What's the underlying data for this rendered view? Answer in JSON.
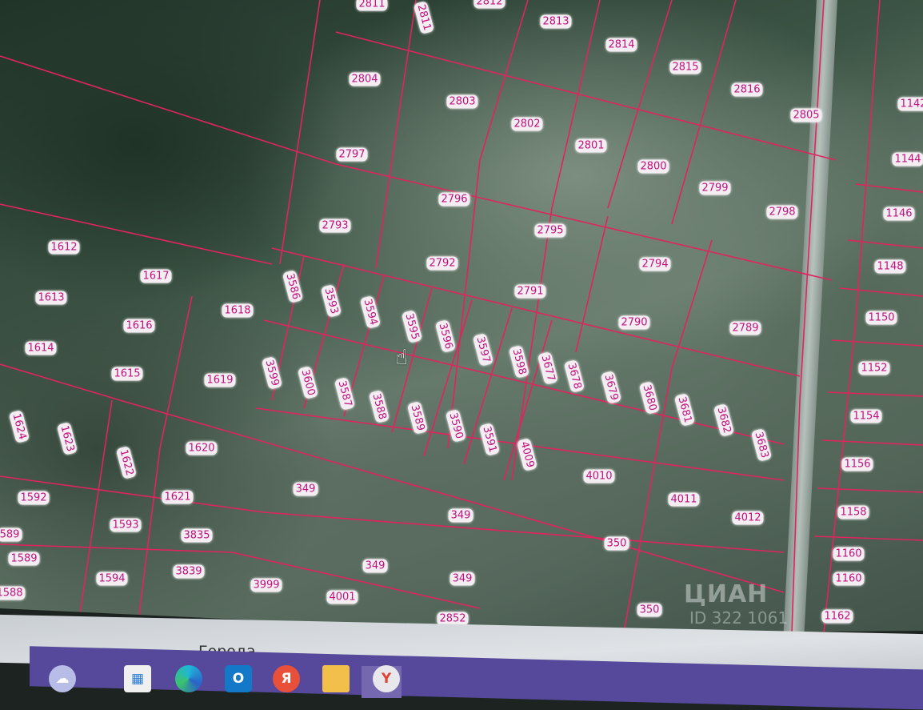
{
  "map": {
    "parcels": [
      "2811",
      "2811",
      "2812",
      "2813",
      "2814",
      "2815",
      "2816",
      "2805",
      "1142",
      "2804",
      "2803",
      "2802",
      "2801",
      "2800",
      "2799",
      "2798",
      "1144",
      "2797",
      "2796",
      "2795",
      "1146",
      "2793",
      "2792",
      "2794",
      "1148",
      "1612",
      "1617",
      "3586",
      "3593",
      "3594",
      "2791",
      "1613",
      "1618",
      "1616",
      "3595",
      "3596",
      "3597",
      "3598",
      "3677",
      "3678",
      "2790",
      "2789",
      "1150",
      "1614",
      "1615",
      "1619",
      "3599",
      "3600",
      "3587",
      "3588",
      "3589",
      "3590",
      "3591",
      "3679",
      "3680",
      "3681",
      "3682",
      "3683",
      "1152",
      "1154",
      "1624",
      "1623",
      "1622",
      "1620",
      "4009",
      "4010",
      "349",
      "1156",
      "1592",
      "1621",
      "4011",
      "4012",
      "349",
      "1593",
      "3835",
      "1158",
      "589",
      "1589",
      "350",
      "1594",
      "3839",
      "349",
      "349",
      "1160",
      "1160",
      "1588",
      "3999",
      "4001",
      "2852",
      "350",
      "1162"
    ],
    "watermark": "ЦИАН",
    "watermark_id": "ID 322 1061",
    "parcel_border_color": "#e0245e",
    "label_color": "#c0127e"
  },
  "panel": {
    "title": "Города"
  },
  "taskbar": {
    "icons": [
      "cloud-icon",
      "store-icon",
      "edge-icon",
      "outlook-icon",
      "yandex-icon",
      "folder-icon",
      "yandex-browser-icon"
    ],
    "yandex_letter": "Я",
    "outlook_letter": "O",
    "browser_letter": "Y"
  }
}
